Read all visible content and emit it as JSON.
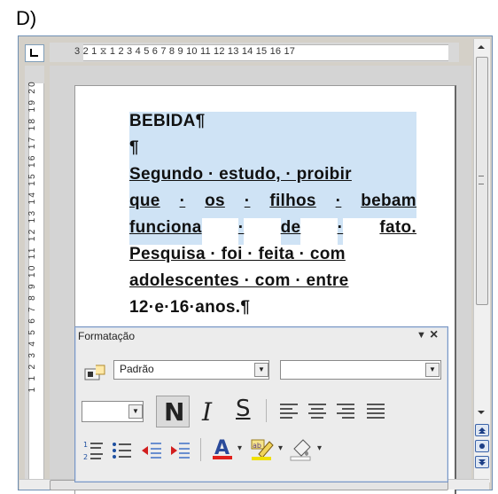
{
  "caption": "D)",
  "ruler": {
    "horizontal": "3 2 1 ⧖ 1 2 3 4 5 6 7 8 9 10 11 12 13 14 15 16 17",
    "vertical": "1 1 2 3 4 5 6 7 8 9 10 11 12 13 14 15 16 17 18 19 20"
  },
  "document": {
    "line1": "BEBIDA¶",
    "line2": "¶",
    "line3": "Segundo · estudo, · proibir",
    "line4_words": [
      "que",
      "·",
      "os",
      "·",
      "filhos",
      "·",
      "bebam"
    ],
    "line5_words": [
      "funciona",
      "·",
      "de",
      "·",
      "fato."
    ],
    "line6": "Pesquisa · foi · feita · com",
    "line7": "adolescentes · com · entre",
    "line8": "12·e·16·anos.¶"
  },
  "format_toolbar": {
    "title": "Formatação",
    "style_value": "Padrão",
    "font_value": "",
    "size_value": "",
    "bold_label": "N",
    "italic_label": "I",
    "underline_label": "S"
  },
  "icons": {
    "tab": "tab-stop-icon",
    "styles": "styles-icon",
    "font_color": "font-color-icon",
    "highlight": "highlight-icon",
    "background": "background-color-icon"
  },
  "colors": {
    "selection": "#cfe3f5",
    "toolbar_border": "#7a96c3",
    "font_color_bar": "#e0201c",
    "highlight_bar": "#f0e000",
    "indent_arrow": "#d21e1e"
  }
}
